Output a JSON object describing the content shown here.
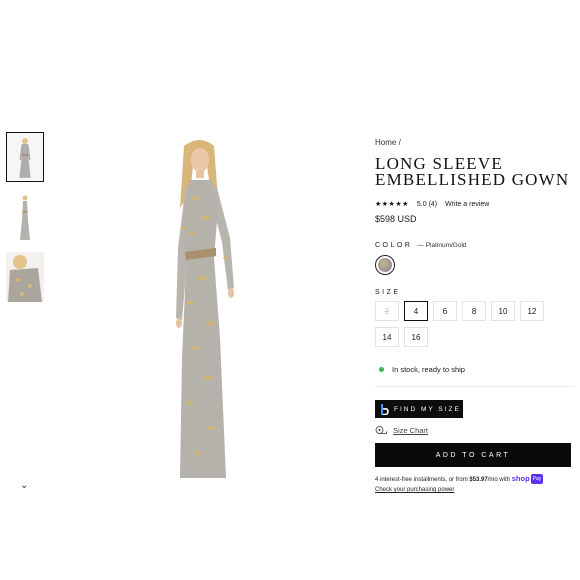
{
  "breadcrumb": {
    "home": "Home",
    "separator": "/"
  },
  "product": {
    "title": "LONG SLEEVE EMBELLISHED GOWN",
    "rating_stars": "★★★★★",
    "rating_value": "5.0",
    "rating_count": "(4)",
    "write_review": "Write a review",
    "price": "$598 USD"
  },
  "color": {
    "label": "COLOR",
    "value": "— Platinum/Gold"
  },
  "size": {
    "label": "SIZE",
    "options": [
      "2",
      "4",
      "6",
      "8",
      "10",
      "12",
      "14",
      "16"
    ],
    "selected": "4",
    "unavailable": [
      "2"
    ]
  },
  "stock": {
    "text": "In stock, ready to ship",
    "status_color": "#3fb554"
  },
  "find_my_size": {
    "label": "FIND MY SIZE",
    "logo_icon": "b-logo-icon"
  },
  "size_chart": {
    "label": "Size Chart",
    "icon": "tape-measure-icon"
  },
  "cart": {
    "label": "ADD TO CART"
  },
  "installments": {
    "prefix": "4 interest-free installments, or from",
    "amount": "$53.97",
    "suffix": "/mo with",
    "brand": "shop",
    "badge": "Pay",
    "learn": "Check your purchasing power"
  },
  "gallery": {
    "thumbnails": [
      "gown-front-thumbnail",
      "gown-full-thumbnail",
      "gown-closeup-thumbnail"
    ],
    "selected_index": 0,
    "more_icon": "chevron-down-icon"
  },
  "colors": {
    "accent": "#0a0a0a",
    "shop_pay": "#5a31f4"
  }
}
